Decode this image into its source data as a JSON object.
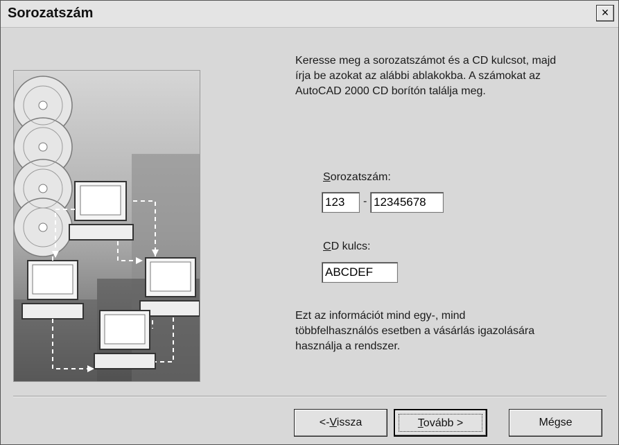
{
  "window": {
    "title": "Sorozatszám",
    "close_label": "×"
  },
  "intro_text": "Keresse meg a sorozatszámot és a CD kulcsot, majd írja be azokat az alábbi ablakokba. A számokat az AutoCAD 2000 CD borítón találja meg.",
  "serial": {
    "label_accel": "S",
    "label_rest": "orozatszám:",
    "part1": "123",
    "separator": "-",
    "part2": "12345678"
  },
  "cd_key": {
    "label_accel": "C",
    "label_rest": "D kulcs:",
    "value": "ABCDEF"
  },
  "footer_text": "Ezt az információt mind egy-, mind többfelhasználós esetben a vásárlás igazolására használja a rendszer.",
  "buttons": {
    "back_prefix": "<-",
    "back_accel": "V",
    "back_rest": "issza",
    "next_accel": "T",
    "next_rest": "ovább >",
    "cancel": "Mégse"
  }
}
